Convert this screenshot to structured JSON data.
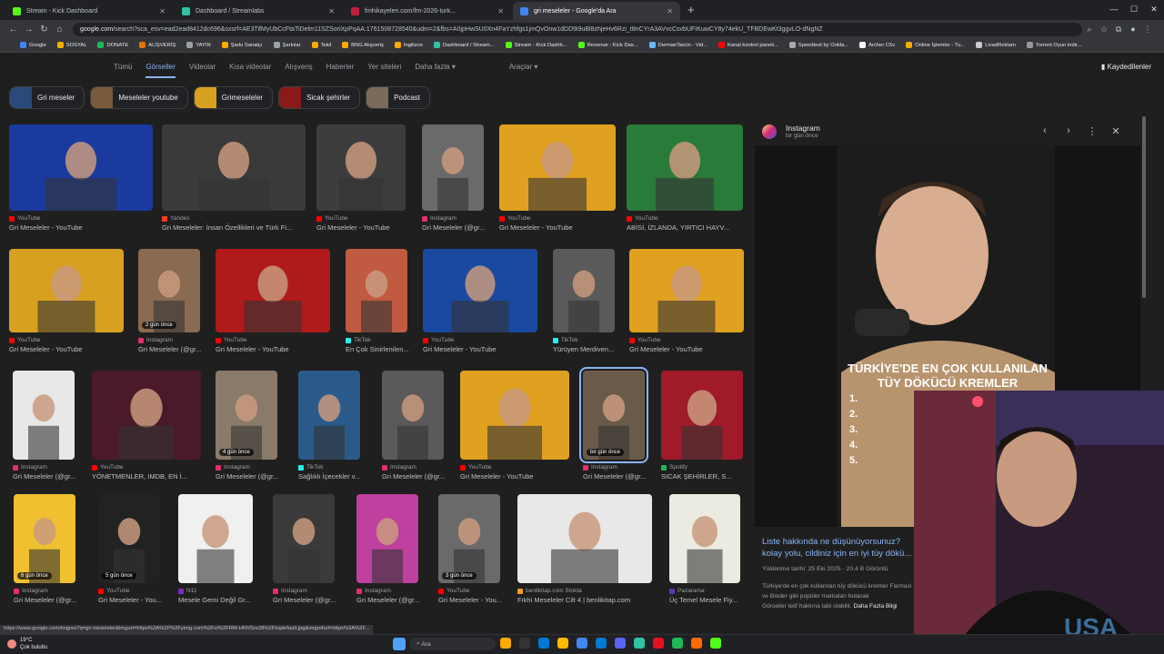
{
  "browser": {
    "tabs": [
      {
        "title": "Stream - Kick Dashboard",
        "color": "#53fc18",
        "active": false
      },
      {
        "title": "Dashboard / Streamlabs",
        "color": "#31c3a2",
        "active": false
      },
      {
        "title": "fmhikayeleri.com/fm-2026-turk...",
        "color": "#c41e3a",
        "active": false
      },
      {
        "title": "gri meseleler - Google'da Ara",
        "color": "#4285f4",
        "active": true
      }
    ],
    "new_tab": "+",
    "url_host": "google.com",
    "url_rest": "/search?sca_esv=ead2ead8412dc696&sxsrf=AE3TifMyUbCcFtaTiDelm11SZSoriXpPqAA:1761508728540&udm=2&fbs=AIIjpHwSU0Xn4FaYzhfgs1jmQvOnw1dDD9i9uBl8zhjeHv6Rzi_t8nCYrA3AVvcCsvbUFIKuwCY8y74ekU_TFBDEwKt3ggvLO-dNgNZ"
  },
  "bookmarks": [
    "Google",
    "SOSYAL",
    "DONATE",
    "ALIŞVERİŞ",
    "YAYIN",
    "Şarkı Sanatçı",
    "Şarkılar",
    "Tekil",
    "BNG Alışveriş",
    "İngilizce",
    "Dashboard / Stream...",
    "Stream - Kick Dashb...",
    "Revenue - Kick Das...",
    "DermanTarcin - Vid...",
    "Kanal kontrol paneli...",
    "Speedtest by Ookla...",
    "Archer C5v",
    "Online İşlemler - Tu...",
    "LivadReklam",
    "Torrent Oyun indir..."
  ],
  "google_nav": {
    "items": [
      "Tümü",
      "Görseller",
      "Videolar",
      "Kısa videolar",
      "Alışveriş",
      "Haberler",
      "Yer siteleri",
      "Daha fazla ▾"
    ],
    "active": "Görseller",
    "tools": "Araçlar ▾",
    "saved": "Kaydedilenler"
  },
  "chips": [
    "Gri meseler",
    "Meseleler youtube",
    "Grimeseleler",
    "Sicak şehirler",
    "Podcast"
  ],
  "results": [
    {
      "src": "YouTube",
      "title": "Gri Meseleler - YouTube",
      "src_color": "#ff0000",
      "badge": ""
    },
    {
      "src": "Yandex",
      "title": "Gri Meseleler: İnsan Özellikleri ve Türk Fi...",
      "src_color": "#fc3f1d",
      "badge": ""
    },
    {
      "src": "YouTube",
      "title": "Gri Meseleler - YouTube",
      "src_color": "#ff0000",
      "badge": ""
    },
    {
      "src": "Instagram",
      "title": "Gri Meseleler (@gr...",
      "src_color": "#e1306c",
      "badge": ""
    },
    {
      "src": "YouTube",
      "title": "Gri Meseleler - YouTube",
      "src_color": "#ff0000",
      "badge": ""
    },
    {
      "src": "YouTube",
      "title": "ABİSİ, İZLANDA, YIRTICI HAYV...",
      "src_color": "#ff0000",
      "badge": ""
    },
    {
      "src": "YouTube",
      "title": "Gri Meseleler - YouTube",
      "src_color": "#ff0000",
      "badge": ""
    },
    {
      "src": "Instagram",
      "title": "Gri Meseleler (@gr...",
      "src_color": "#e1306c",
      "badge": "2 gün önce"
    },
    {
      "src": "YouTube",
      "title": "Gri Meseleler - YouTube",
      "src_color": "#ff0000",
      "badge": ""
    },
    {
      "src": "TikTok",
      "title": "En Çok Sinirlenilen...",
      "src_color": "#25f4ee",
      "badge": ""
    },
    {
      "src": "YouTube",
      "title": "Gri Meseleler - YouTube",
      "src_color": "#ff0000",
      "badge": ""
    },
    {
      "src": "TikTok",
      "title": "Yürüyen Merdiven...",
      "src_color": "#25f4ee",
      "badge": ""
    },
    {
      "src": "YouTube",
      "title": "Gri Meseleler - YouTube",
      "src_color": "#ff0000",
      "badge": ""
    },
    {
      "src": "Instagram",
      "title": "Gri Meseleler (@gr...",
      "src_color": "#e1306c",
      "badge": ""
    },
    {
      "src": "YouTube",
      "title": "YÖNETMENLER, IMDB, EN İ...",
      "src_color": "#ff0000",
      "badge": ""
    },
    {
      "src": "Instagram",
      "title": "Gri Meseleler (@gr...",
      "src_color": "#e1306c",
      "badge": "4 gün önce"
    },
    {
      "src": "TikTok",
      "title": "Sağlıklı İçecekler v...",
      "src_color": "#25f4ee",
      "badge": ""
    },
    {
      "src": "Instagram",
      "title": "Gri Meseleler (@gr...",
      "src_color": "#e1306c",
      "badge": ""
    },
    {
      "src": "YouTube",
      "title": "Gri Meseleler - YouTube",
      "src_color": "#ff0000",
      "badge": ""
    },
    {
      "src": "Instagram",
      "title": "Gri Meseleler (@gr...",
      "src_color": "#e1306c",
      "badge": "bir gün önce"
    },
    {
      "src": "Spotify",
      "title": "SICAK ŞEHİRLER, S...",
      "src_color": "#1db954",
      "badge": ""
    },
    {
      "src": "Instagram",
      "title": "Gri Meseleler (@gr...",
      "src_color": "#e1306c",
      "badge": "6 gün önce"
    },
    {
      "src": "YouTube",
      "title": "Gri Meseleler - You...",
      "src_color": "#ff0000",
      "badge": "5 gün önce"
    },
    {
      "src": "N11",
      "title": "Mesele Gemi Değil Gr...",
      "src_color": "#7b2cbf",
      "badge": ""
    },
    {
      "src": "Instagram",
      "title": "Gri Meseleler (@gr...",
      "src_color": "#e1306c",
      "badge": ""
    },
    {
      "src": "Instagram",
      "title": "Gri Meseleler (@gr...",
      "src_color": "#e1306c",
      "badge": ""
    },
    {
      "src": "YouTube",
      "title": "Gri Meseleler - You...",
      "src_color": "#ff0000",
      "badge": "3 gün önce"
    },
    {
      "src": "benlikitap.com  Stokta",
      "title": "Fıkhi Meseleler Cilt 4 | benlikitap.com",
      "src_color": "#f29c1f",
      "badge": ""
    },
    {
      "src": "Pazarama",
      "title": "Üç Temel Mesele Fiy...",
      "src_color": "#5e35b1",
      "badge": ""
    }
  ],
  "panel": {
    "source": "Instagram",
    "time": "bir gün önce",
    "overlay_text": "TÜRKİYE'DE EN ÇOK KULLANILAN TÜY DÖKÜCÜ KREMLER",
    "list": [
      "1.",
      "2.",
      "3.",
      "4.",
      "5."
    ],
    "title": "Liste hakkında ne düşünüyorsunuz? kolay yolu, cildiniz için en iyi tüy dökü...",
    "meta": "Yüklenme tarihi: 25 Eki 2025  ·  20,4 B Görüntü",
    "desc": "Türkiye'de en çok kullanılan tüy dökücü kremler Farmasi ve Bioder gibi popüler markaları bulacak",
    "more_label": "Görseller telif hakkına tabi olabilir.",
    "more_link": "Daha Fazla Bilgi"
  },
  "status_url": "https://www.google.com/imgres?q=gri meseleler&imgurl=https%3A%2F%2Fyimg.com%2Fvi%2FRM-HNVSre28%2Fhqdefault.jpg&imgrefurl=https%3A%2F...",
  "taskbar": {
    "weather_temp": "19°C",
    "weather_desc": "Çok bulutlu",
    "search": "Ara"
  }
}
